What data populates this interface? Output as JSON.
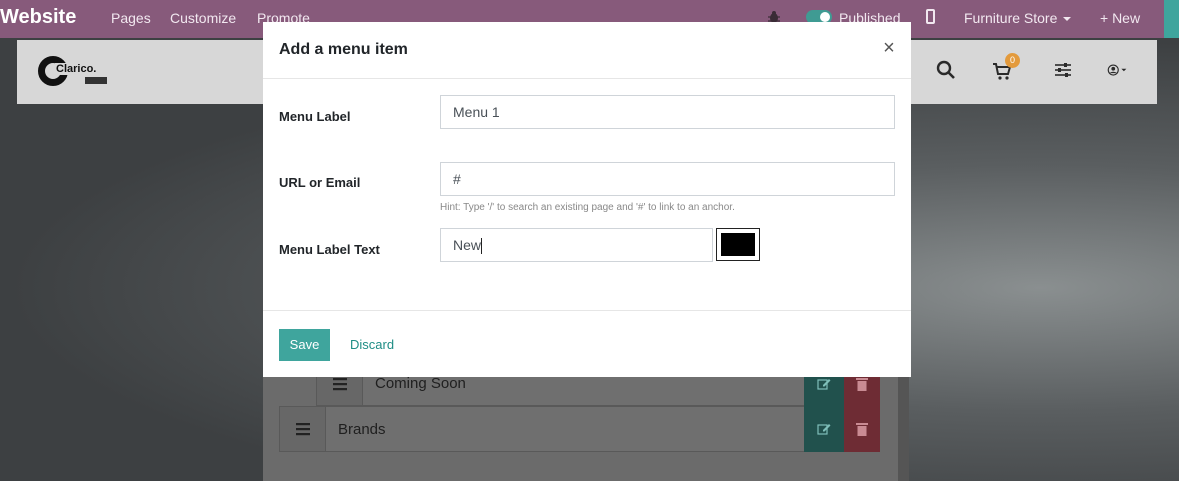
{
  "admin_bar": {
    "brand": "Website",
    "nav": [
      "Pages",
      "Customize",
      "Promote"
    ],
    "published_label": "Published",
    "website_selector": "Furniture Store",
    "new_label": "+ New"
  },
  "site_header": {
    "logo_text": "Clarico.",
    "cart_count": "0"
  },
  "menu_items": [
    {
      "label": "Coming Soon"
    },
    {
      "label": "Brands"
    }
  ],
  "modal": {
    "title": "Add a menu item",
    "close_symbol": "×",
    "fields": {
      "menu_label": {
        "label": "Menu Label",
        "value": "Menu 1"
      },
      "url": {
        "label": "URL or Email",
        "value": "#",
        "hint": "Hint: Type '/' to search an existing page and '#' to link to an anchor."
      },
      "label_text": {
        "label": "Menu Label Text",
        "value": "New",
        "color": "#000000"
      }
    },
    "save_label": "Save",
    "discard_label": "Discard"
  },
  "colors": {
    "admin_bar": "#875a7b",
    "primary": "#3fa59d",
    "link": "#1f8d85"
  }
}
